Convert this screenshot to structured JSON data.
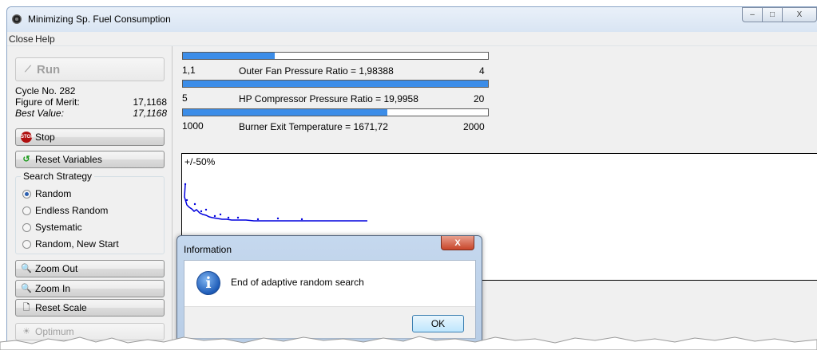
{
  "window": {
    "title": "Minimizing Sp. Fuel Consumption",
    "controls": [
      "–",
      "□",
      "X"
    ]
  },
  "menu": {
    "items": [
      "Close",
      "Help"
    ]
  },
  "left_panel": {
    "run_label": "Run",
    "cycle": "Cycle No. 282",
    "figure_of_merit_label": "Figure of Merit:",
    "figure_of_merit_value": "17,1168",
    "best_value_label": "Best Value:",
    "best_value_value": "17,1168",
    "stop_label": "Stop",
    "reset_variables_label": "Reset Variables",
    "search_strategy": {
      "title": "Search Strategy",
      "options": [
        "Random",
        "Endless Random",
        "Systematic",
        "Random, New Start"
      ],
      "selected": "Random"
    },
    "zoom_out_label": "Zoom Out",
    "zoom_in_label": "Zoom In",
    "reset_scale_label": "Reset Scale",
    "optimum_label": "Optimum"
  },
  "variables": [
    {
      "min": "1,1",
      "max": "4",
      "label": "Outer Fan Pressure Ratio = 1,98388",
      "fraction": 0.3
    },
    {
      "min": "5",
      "max": "20",
      "label": "HP Compressor Pressure Ratio = 19,9958",
      "fraction": 1.0
    },
    {
      "min": "1000",
      "max": "2000",
      "label": "Burner Exit Temperature = 1671,72",
      "fraction": 0.67
    }
  ],
  "plot": {
    "scale_label": "+/-50%",
    "color": "#0000dd"
  },
  "dialog": {
    "title": "Information",
    "close_label": "X",
    "message": "End of adaptive random search",
    "ok_label": "OK"
  }
}
